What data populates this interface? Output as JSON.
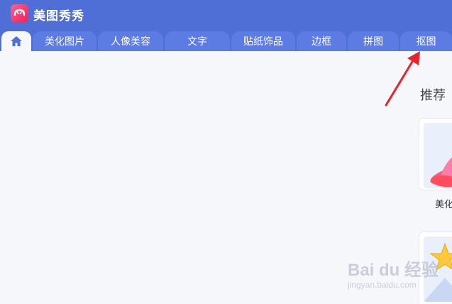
{
  "app": {
    "title": "美图秀秀",
    "logo_icon": "meitu-logo-icon"
  },
  "tabs": [
    {
      "label": "",
      "icon": "home-icon"
    },
    {
      "label": "美化图片"
    },
    {
      "label": "人像美容"
    },
    {
      "label": "文字"
    },
    {
      "label": "贴纸饰品"
    },
    {
      "label": "边框"
    },
    {
      "label": "拼图"
    },
    {
      "label": "抠图"
    }
  ],
  "main": {
    "section_title": "推荐",
    "cards": [
      {
        "label": "美化",
        "icon": "flower-icon"
      },
      {
        "label": "",
        "icon": "star-icon"
      }
    ]
  },
  "watermark": {
    "text": "Bai du 经验",
    "sub": "jingyan.baidu.com"
  },
  "annotation": {
    "arrow_color": "#e8232e"
  },
  "colors": {
    "titlebar": "#4f6fd6",
    "tab": "#5c7ce4",
    "content_bg": "#f6f7fb"
  }
}
